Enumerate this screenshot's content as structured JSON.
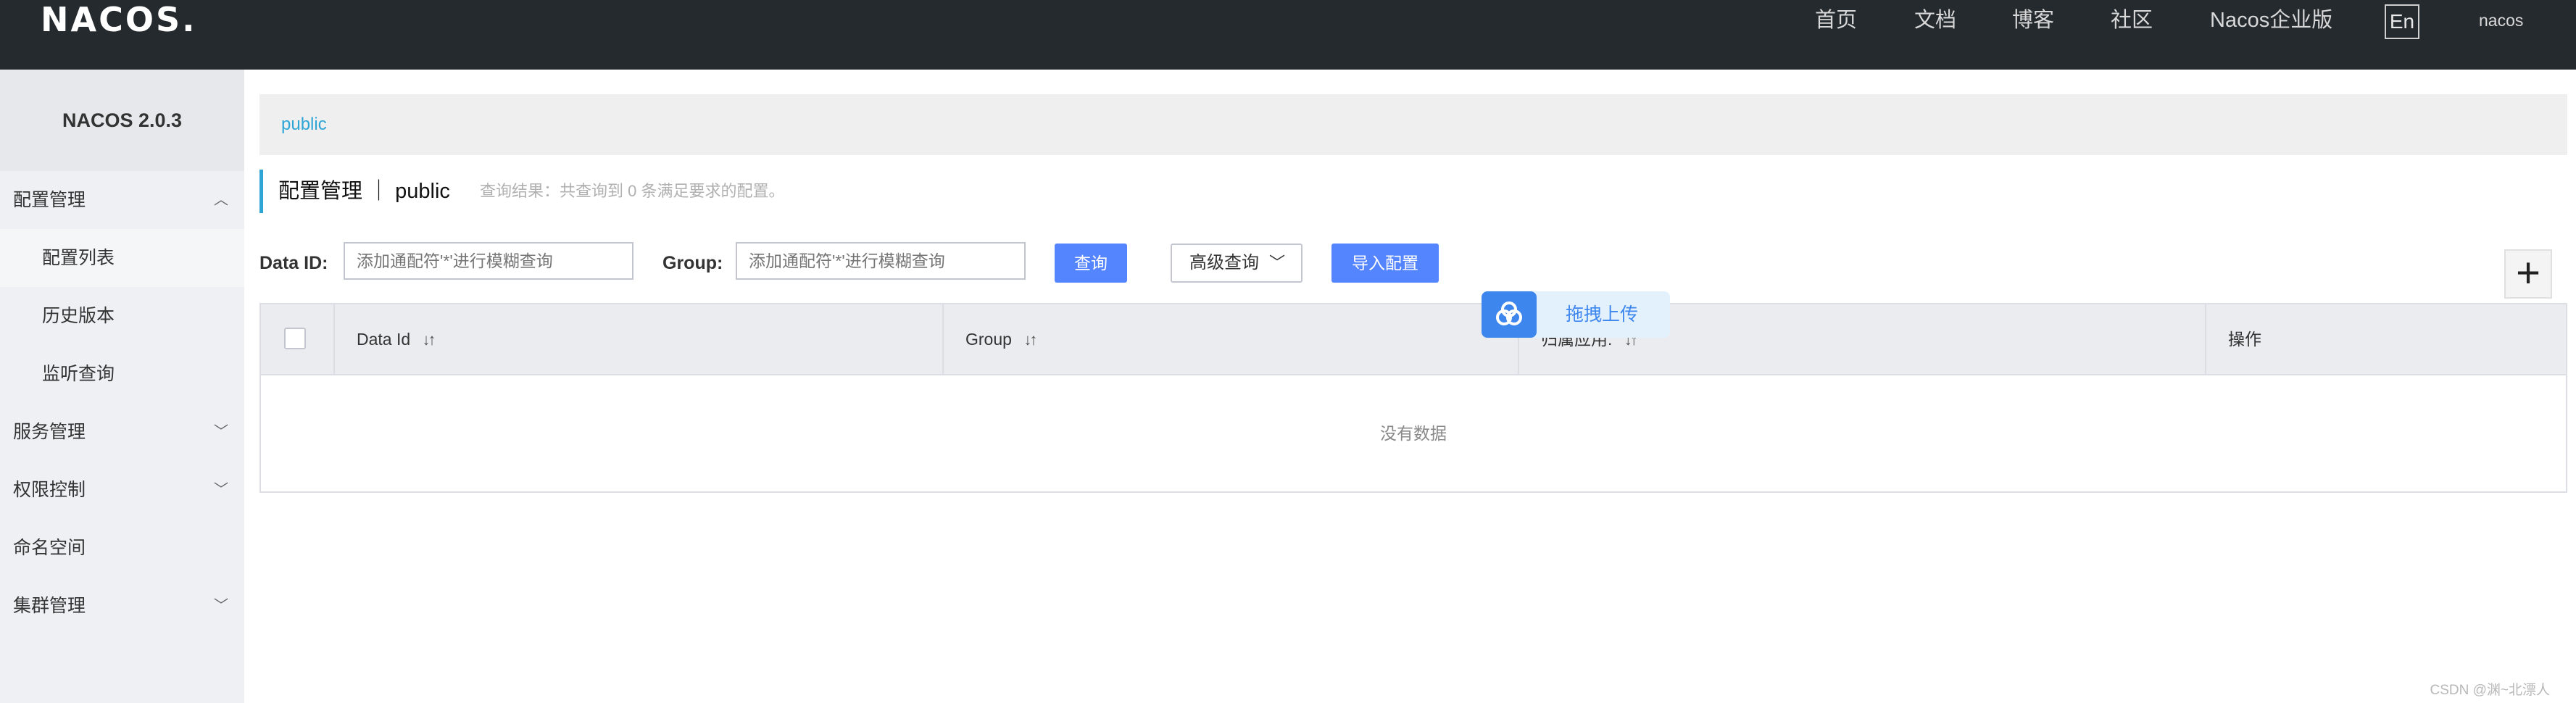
{
  "header": {
    "logo": "NACOS.",
    "nav": [
      "首页",
      "文档",
      "博客",
      "社区",
      "Nacos企业版"
    ],
    "language": "En",
    "username": "nacos"
  },
  "sidebar": {
    "title": "NACOS 2.0.3",
    "items": [
      {
        "label": "配置管理",
        "expanded": true
      },
      {
        "label": "配置列表",
        "sub": true,
        "active": true
      },
      {
        "label": "历史版本",
        "sub": true
      },
      {
        "label": "监听查询",
        "sub": true
      },
      {
        "label": "服务管理",
        "expanded": false
      },
      {
        "label": "权限控制",
        "expanded": false
      },
      {
        "label": "命名空间"
      },
      {
        "label": "集群管理",
        "expanded": false
      }
    ]
  },
  "breadcrumb": {
    "namespace": "public"
  },
  "page": {
    "title": "配置管理 ｜ public",
    "result": "查询结果：共查询到 0 条满足要求的配置。"
  },
  "filters": {
    "data_id_label": "Data ID:",
    "data_id_placeholder": "添加通配符'*'进行模糊查询",
    "group_label": "Group:",
    "group_placeholder": "添加通配符'*'进行模糊查询",
    "query_button": "查询",
    "advanced_button": "高级查询",
    "import_button": "导入配置"
  },
  "table": {
    "columns": [
      "Data Id",
      "Group",
      "归属应用:",
      "操作"
    ],
    "empty_text": "没有数据"
  },
  "upload_widget": {
    "label": "拖拽上传"
  },
  "watermark": "CSDN @渊~北漂人",
  "colors": {
    "header_bg": "#252a2f",
    "sidebar_bg": "#eef0f3",
    "primary": "#5584ff",
    "link": "#2fa5d6",
    "upload_blue": "#3d86ee"
  }
}
